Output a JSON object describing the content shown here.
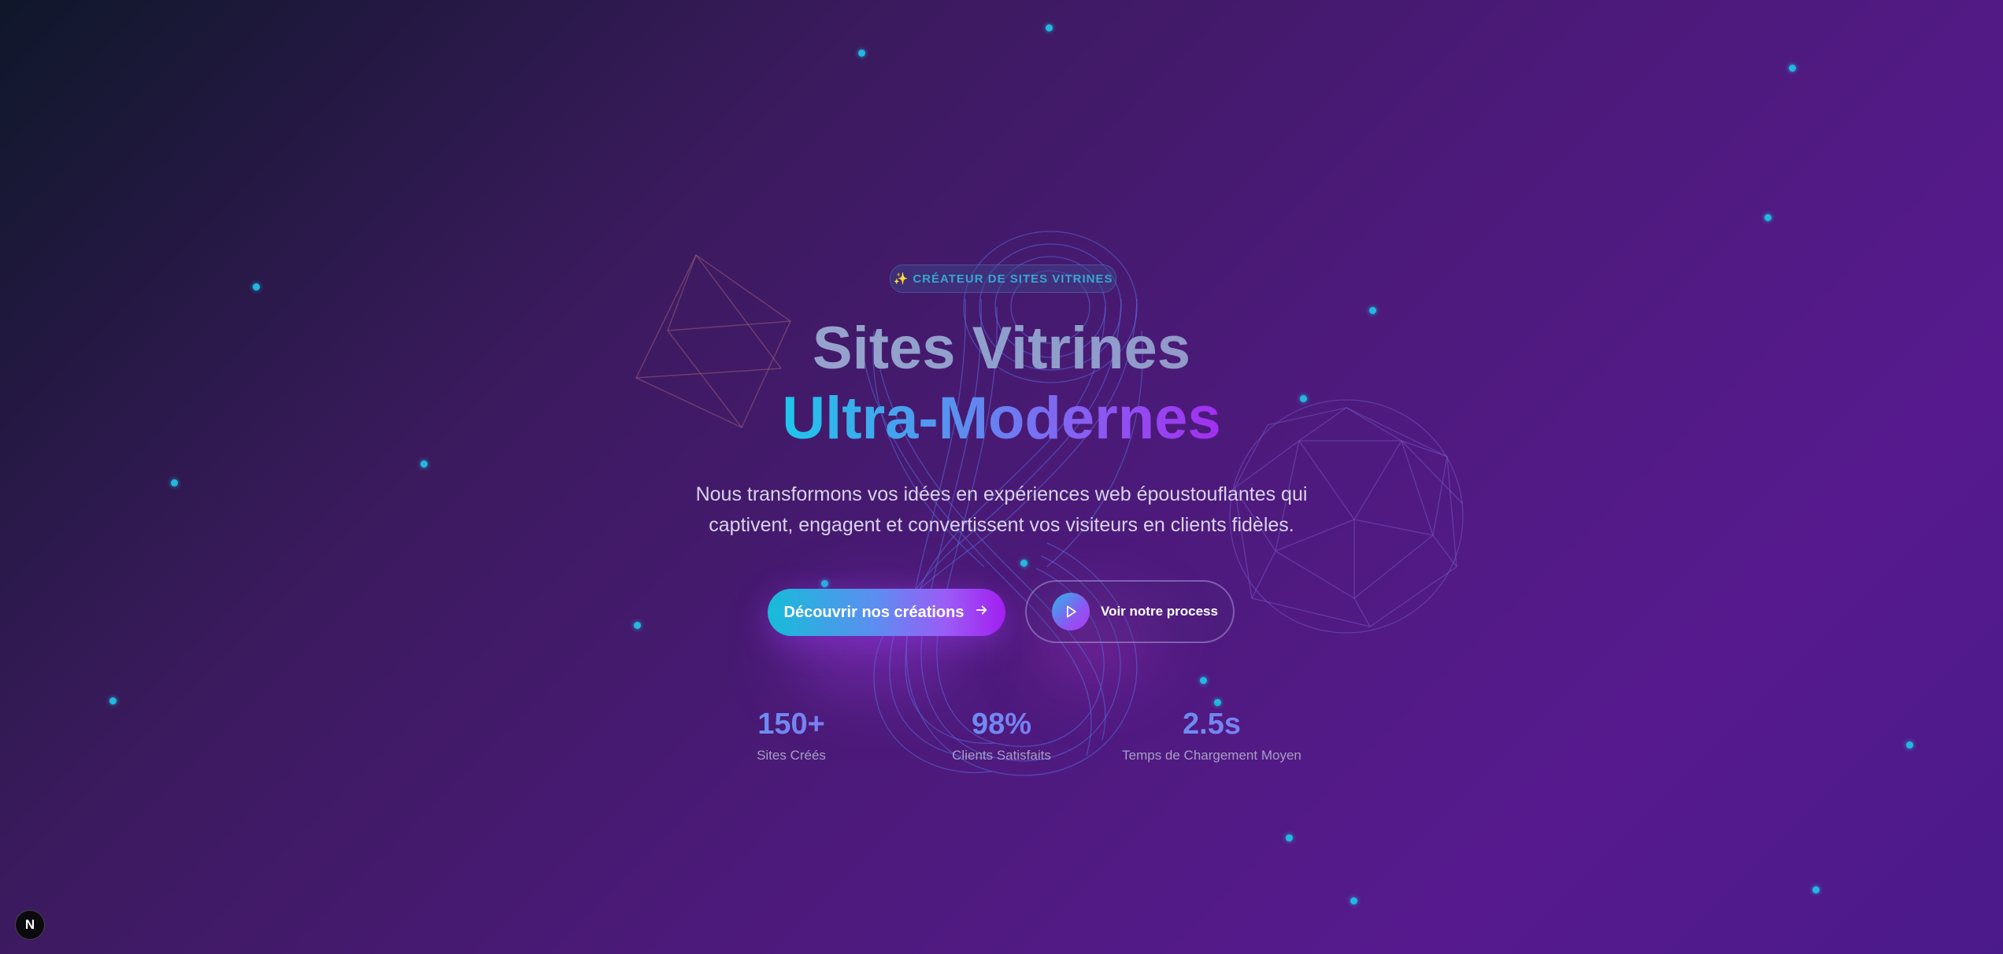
{
  "badge": {
    "text": "✨ CRÉATEUR DE SITES VITRINES"
  },
  "hero": {
    "title_line1": "Sites Vitrines",
    "title_line2": "Ultra-Modernes",
    "subtitle_line1": "Nous transformons vos idées en expériences web époustouflantes qui",
    "subtitle_line2": "captivent, engagent et convertissent vos visiteurs en clients fidèles."
  },
  "actions": {
    "primary_label": "Découvrir nos créations",
    "secondary_label": "Voir notre process"
  },
  "stats": [
    {
      "value": "150+",
      "label": "Sites Créés"
    },
    {
      "value": "98%",
      "label": "Clients Satisfaits"
    },
    {
      "value": "2.5s",
      "label": "Temps de Chargement Moyen"
    }
  ],
  "dev_badge": {
    "letter": "N"
  },
  "colors": {
    "accent_cyan": "#22b8e0",
    "accent_purple": "#a21ff0",
    "background_dark": "#0f172a",
    "background_purple": "#561a8e"
  },
  "icons": [
    "arrow-right-icon",
    "play-icon",
    "nextjs-logo-icon"
  ]
}
